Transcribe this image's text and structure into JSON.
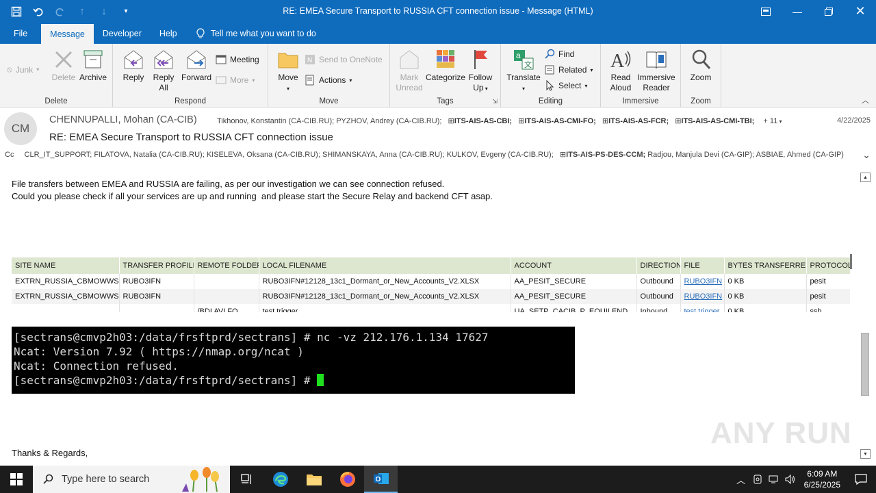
{
  "window": {
    "title": "RE: EMEA Secure Transport to RUSSIA CFT connection issue  -  Message (HTML)"
  },
  "menu": {
    "tabs": [
      "File",
      "Message",
      "Developer",
      "Help"
    ],
    "tell_me": "Tell me what you want to do"
  },
  "ribbon": {
    "delete": {
      "label": "Delete",
      "junk": "Junk",
      "delete": "Delete",
      "archive": "Archive"
    },
    "respond": {
      "label": "Respond",
      "reply": "Reply",
      "reply_all_1": "Reply",
      "reply_all_2": "All",
      "forward": "Forward",
      "meeting": "Meeting",
      "more": "More"
    },
    "move": {
      "label": "Move",
      "move": "Move",
      "onenote": "Send to OneNote",
      "actions": "Actions"
    },
    "tags": {
      "label": "Tags",
      "mark_1": "Mark",
      "mark_2": "Unread",
      "categorize": "Categorize",
      "follow_1": "Follow",
      "follow_2": "Up"
    },
    "editing": {
      "label": "Editing",
      "translate": "Translate",
      "find": "Find",
      "related": "Related",
      "select": "Select"
    },
    "immersive": {
      "label": "Immersive",
      "read_1": "Read",
      "read_2": "Aloud",
      "reader_1": "Immersive",
      "reader_2": "Reader"
    },
    "zoom": {
      "label": "Zoom",
      "zoom": "Zoom"
    }
  },
  "header": {
    "initials": "CM",
    "sender": "CHENNUPALLI, Mohan (CA-CIB)",
    "to_plain": "Tikhonov, Konstantin (CA-CIB.RU); PYZHOV, Andrey (CA-CIB.RU);",
    "to_groups": [
      "ITS-AIS-AS-CBI;",
      "ITS-AIS-AS-CMI-FO;",
      "ITS-AIS-AS-FCR;",
      "ITS-AIS-AS-CMI-TBI;"
    ],
    "more_recipients": "+ 11",
    "date": "4/22/2025",
    "subject": "RE: EMEA Secure Transport to RUSSIA CFT connection issue",
    "cc_label": "Cc",
    "cc_1": "CLR_IT_SUPPORT; FILATOVA, Natalia (CA-CIB.RU); KISELEVA, Oksana (CA-CIB.RU); SHIMANSKAYA, Anna (CA-CIB.RU); KULKOV, Evgeny (CA-CIB.RU);",
    "cc_group": "ITS-AIS-PS-DES-CCM;",
    "cc_2": "Radjou, Manjula Devi (CA-GIP); ASBIAE, Ahmed (CA-GIP)"
  },
  "body": {
    "line1": "File transfers between EMEA and RUSSIA are failing, as per our investigation we can see connection refused.",
    "line2": "Could you please check if all your services are up and running  and please start the Secure Relay and backend CFT asap.",
    "table": {
      "headers": [
        "SITE NAME",
        "TRANSFER PROFILE",
        "REMOTE FOLDER",
        "LOCAL FILENAME",
        "ACCOUNT",
        "DIRECTION",
        "FILE",
        "BYTES TRANSFERRED",
        "PROTOCOL"
      ],
      "rows": [
        [
          "EXTRN_RUSSIA_CBMOWWSL",
          "RUBO3IFN",
          "",
          "RUBO3IFN#12128_13c1_Dormant_or_New_Accounts_V2.XLSX",
          "AA_PESIT_SECURE",
          "Outbound",
          "RUBO3IFN",
          "0 KB",
          "pesit"
        ],
        [
          "EXTRN_RUSSIA_CBMOWWSL",
          "RUBO3IFN",
          "",
          "RUBO3IFN#12128_13c1_Dormant_or_New_Accounts_V2.XLSX",
          "AA_PESIT_SECURE",
          "Outbound",
          "RUBO3IFN",
          "0 KB",
          "pesit"
        ],
        [
          "",
          "",
          "/BDI AVLFO",
          "test trigger",
          "UA_SETP_CACIB_P_EQUILEND",
          "Inbound",
          "test trigger",
          "0 KB",
          "ssh"
        ]
      ]
    },
    "terminal": {
      "line1": "[sectrans@cmvp2h03:/data/frsftprd/sectrans] # nc -vz 212.176.1.134 17627",
      "line2": "Ncat: Version 7.92 ( https://nmap.org/ncat )",
      "line3": "Ncat: Connection refused.",
      "line4": "[sectrans@cmvp2h03:/data/frsftprd/sectrans] # "
    },
    "closing": "Thanks & Regards,",
    "watermark": "ANY RUN"
  },
  "taskbar": {
    "search_placeholder": "Type here to search",
    "time": "6:09 AM",
    "date": "6/25/2025"
  },
  "colors": {
    "accent": "#0f6cbd",
    "table_header": "#dde6cf",
    "terminal_cursor": "#1ee01e"
  }
}
